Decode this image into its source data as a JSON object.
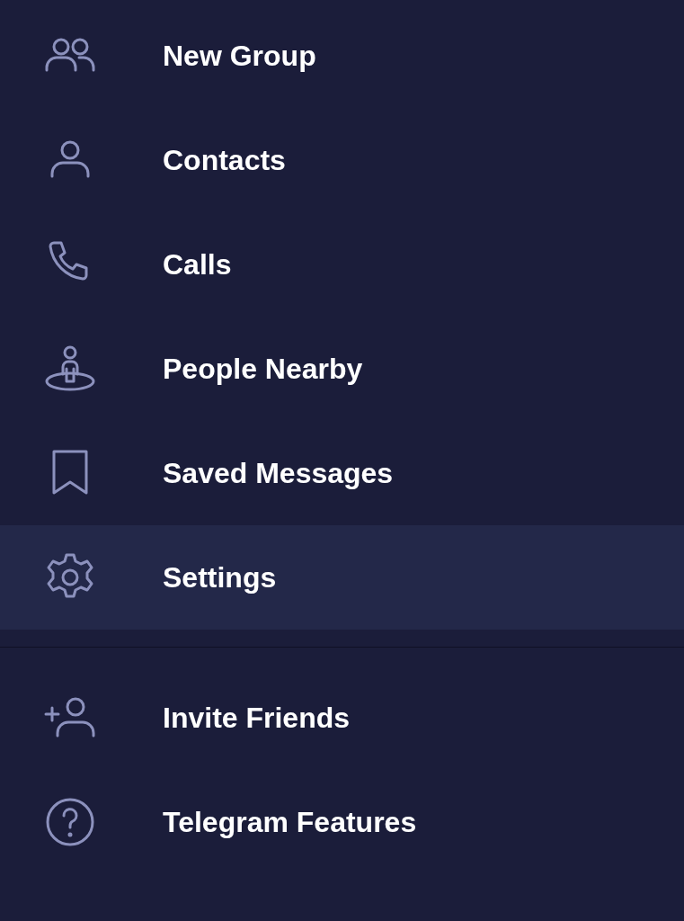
{
  "menu": {
    "sections": [
      {
        "items": [
          {
            "kind": "group",
            "label": "New Group",
            "selected": false
          },
          {
            "kind": "contact",
            "label": "Contacts",
            "selected": false
          },
          {
            "kind": "phone",
            "label": "Calls",
            "selected": false
          },
          {
            "kind": "nearby",
            "label": "People Nearby",
            "selected": false
          },
          {
            "kind": "bookmark",
            "label": "Saved Messages",
            "selected": false
          },
          {
            "kind": "gear",
            "label": "Settings",
            "selected": true
          }
        ]
      },
      {
        "items": [
          {
            "kind": "invite",
            "label": "Invite Friends",
            "selected": false
          },
          {
            "kind": "help",
            "label": "Telegram Features",
            "selected": false
          }
        ]
      }
    ]
  }
}
